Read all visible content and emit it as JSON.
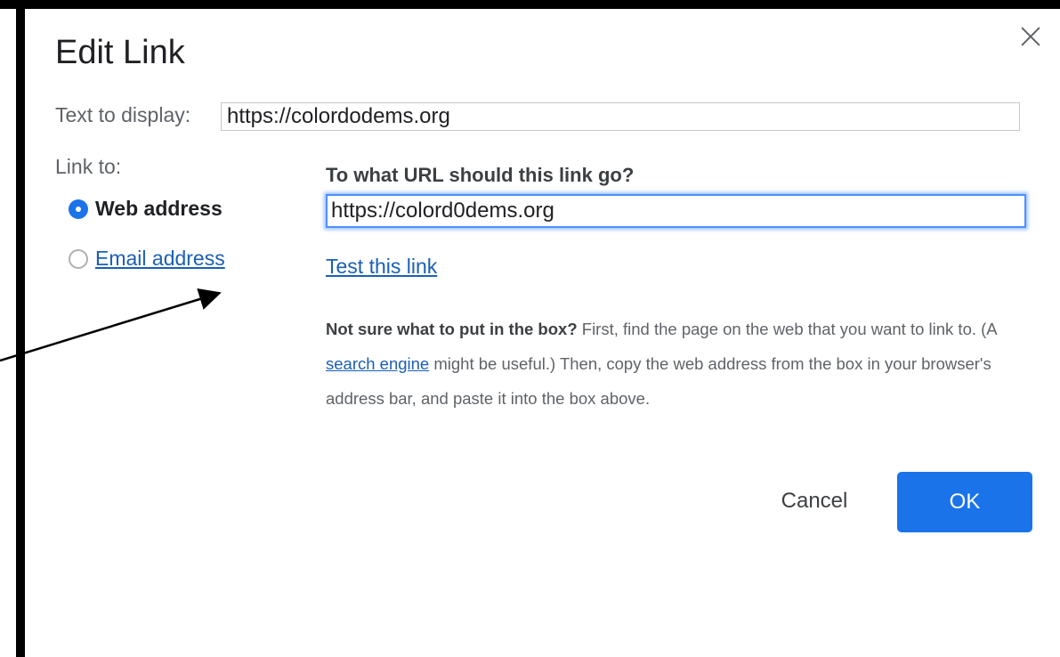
{
  "dialog": {
    "title": "Edit Link",
    "close_icon": "close-icon"
  },
  "text_to_display": {
    "label": "Text to display:",
    "value": "https://colordodems.org"
  },
  "link_to": {
    "label": "Link to:",
    "options": [
      {
        "label": "Web address",
        "selected": true
      },
      {
        "label": "Email address",
        "selected": false
      }
    ]
  },
  "url": {
    "question": "To what URL should this link go?",
    "value": "https://colord0dems.org",
    "test_link": "Test this link"
  },
  "help": {
    "bold": "Not sure what to put in the box?",
    "part1": " First, find the page on the web that you want to link to. (A ",
    "link": "search engine",
    "part2": " might be useful.) Then, copy the web address from the box in your browser's address bar, and paste it into the box above."
  },
  "buttons": {
    "cancel": "Cancel",
    "ok": "OK"
  },
  "colors": {
    "primary": "#1a73e8",
    "link": "#1a5fb4",
    "focus": "#4d90fe"
  }
}
